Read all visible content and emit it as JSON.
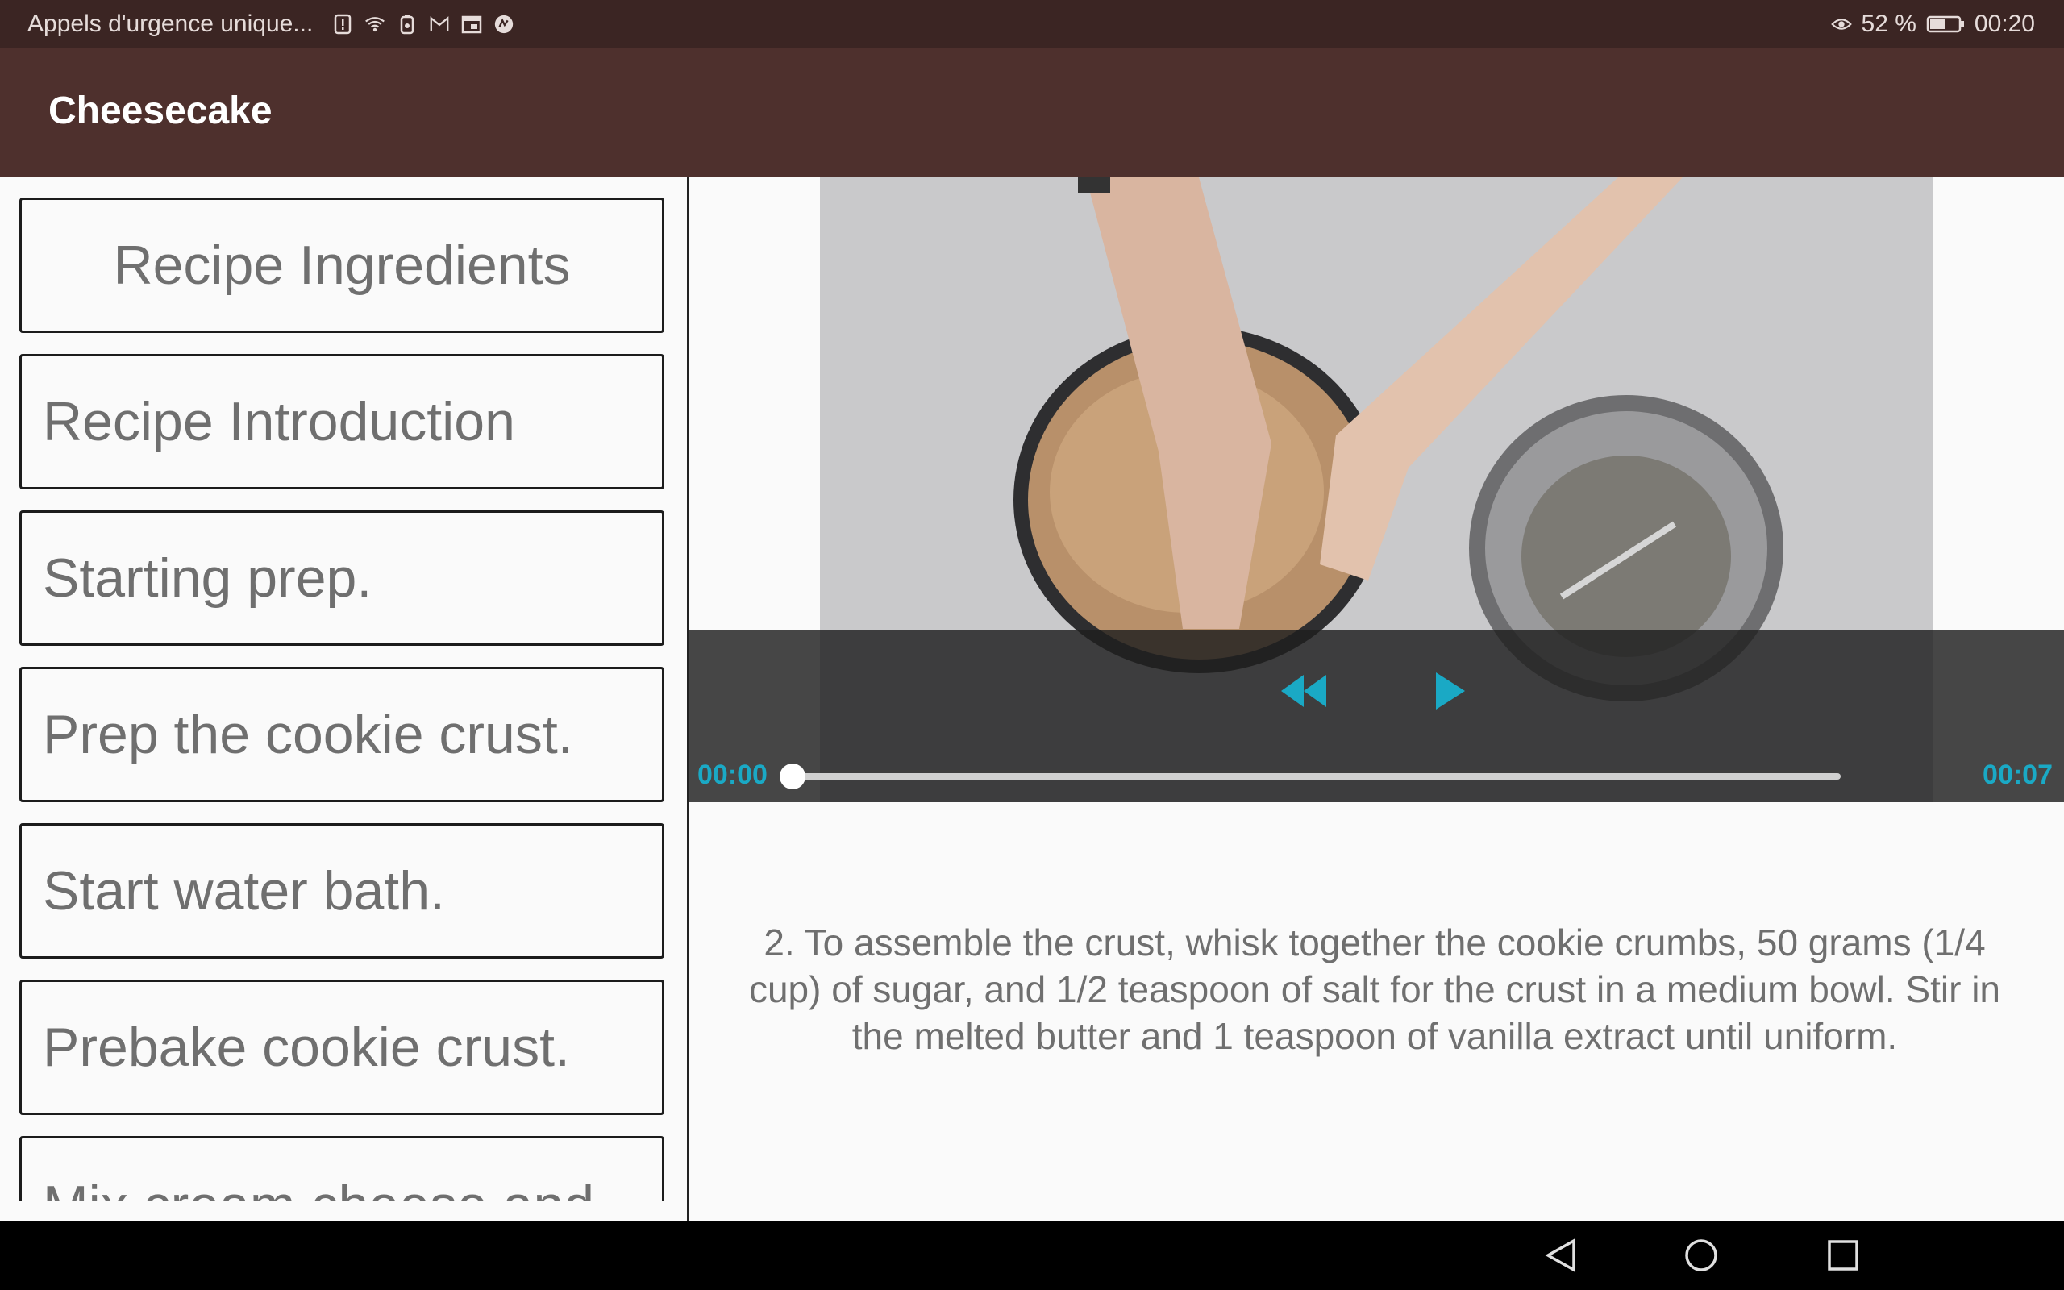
{
  "status_bar": {
    "carrier": "Appels d'urgence unique...",
    "battery": "52 %",
    "time": "00:20",
    "icons_left": [
      "alert-icon",
      "wifi-icon",
      "sim-icon",
      "gmail-icon",
      "calendar-icon",
      "app-icon"
    ],
    "icons_right": [
      "eye-icon",
      "battery-icon"
    ]
  },
  "appbar": {
    "title": "Cheesecake"
  },
  "steps": [
    {
      "label": "Recipe Ingredients"
    },
    {
      "label": "Recipe Introduction"
    },
    {
      "label": "Starting prep."
    },
    {
      "label": "Prep the cookie crust."
    },
    {
      "label": "Start water bath."
    },
    {
      "label": "Prebake cookie crust."
    },
    {
      "label": "Mix cream cheese and"
    }
  ],
  "player": {
    "position": "00:00",
    "duration": "00:07",
    "progress": 0.0,
    "accent_color": "#1aa9c5",
    "buttons": [
      "rewind-icon",
      "play-icon"
    ]
  },
  "description": "2. To assemble the crust, whisk together the cookie crumbs, 50 grams (1/4 cup) of sugar, and 1/2 teaspoon of salt for the crust in a medium bowl. Stir in the melted butter and 1 teaspoon of vanilla extract until uniform.",
  "nav": [
    "back-icon",
    "home-icon",
    "recents-icon"
  ]
}
